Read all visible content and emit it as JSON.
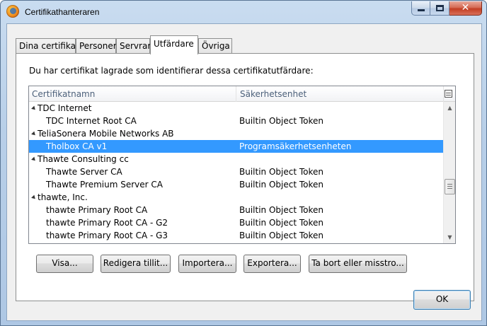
{
  "window": {
    "title": "Certifikathanteraren"
  },
  "tabs": [
    {
      "label": "Dina certifikat",
      "active": false
    },
    {
      "label": "Personer",
      "active": false
    },
    {
      "label": "Servrar",
      "active": false
    },
    {
      "label": "Utfärdare",
      "active": true
    },
    {
      "label": "Övriga",
      "active": false
    }
  ],
  "panel": {
    "description": "Du har certifikat lagrade som identifierar dessa certifikatutfärdare:",
    "columns": {
      "name": "Certifikatnamn",
      "device": "Säkerhetsenhet"
    },
    "rows": [
      {
        "kind": "group",
        "name": "TDC Internet",
        "device": ""
      },
      {
        "kind": "leaf",
        "name": "TDC Internet Root CA",
        "device": "Builtin Object Token"
      },
      {
        "kind": "group",
        "name": "TeliaSonera Mobile Networks AB",
        "device": ""
      },
      {
        "kind": "leaf",
        "name": "Tholbox CA v1",
        "device": "Programsäkerhetsenheten",
        "selected": true
      },
      {
        "kind": "group",
        "name": "Thawte Consulting cc",
        "device": ""
      },
      {
        "kind": "leaf",
        "name": "Thawte Server CA",
        "device": "Builtin Object Token"
      },
      {
        "kind": "leaf",
        "name": "Thawte Premium Server CA",
        "device": "Builtin Object Token"
      },
      {
        "kind": "group",
        "name": "thawte, Inc.",
        "device": ""
      },
      {
        "kind": "leaf",
        "name": "thawte Primary Root CA",
        "device": "Builtin Object Token"
      },
      {
        "kind": "leaf",
        "name": "thawte Primary Root CA - G2",
        "device": "Builtin Object Token"
      },
      {
        "kind": "leaf",
        "name": "thawte Primary Root CA - G3",
        "device": "Builtin Object Token"
      }
    ]
  },
  "buttons": {
    "view": "Visa...",
    "edit_trust": "Redigera tillit...",
    "import": "Importera...",
    "export": "Exportera...",
    "delete": "Ta bort eller misstro...",
    "ok": "OK"
  },
  "icons": {
    "app": "firefox-icon",
    "column_picker": "column-picker-icon"
  }
}
